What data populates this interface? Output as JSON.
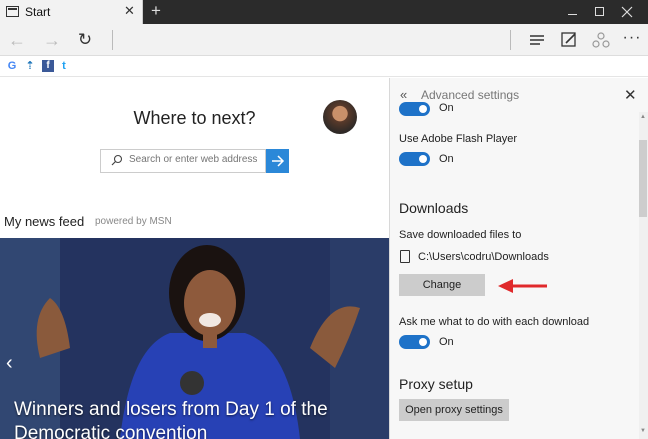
{
  "titlebar": {
    "tab_title": "Start",
    "tab_close": "✕",
    "new_tab": "+"
  },
  "navbar": {
    "back": "←",
    "forward": "→",
    "refresh": "↻",
    "more": "···"
  },
  "favorites": {
    "items": [
      "G",
      "⇡",
      "f",
      "t"
    ]
  },
  "main": {
    "heading": "Where to next?",
    "search_placeholder": "Search or enter web address",
    "news_title": "My news feed",
    "powered_by": "powered by MSN",
    "headline": "Winners and losers from Day 1 of the Democratic convention",
    "prev": "‹"
  },
  "panel": {
    "title": "Advanced settings",
    "back": "«",
    "close": "✕",
    "top_toggle_label": "On",
    "flash_label": "Use Adobe Flash Player",
    "flash_toggle": "On",
    "downloads_heading": "Downloads",
    "save_label": "Save downloaded files to",
    "save_path": "C:\\Users\\codru\\Downloads",
    "change_button": "Change",
    "ask_label": "Ask me what to do with each download",
    "ask_toggle": "On",
    "proxy_heading": "Proxy setup",
    "proxy_button": "Open proxy settings"
  },
  "colors": {
    "accent": "#1e72c8",
    "arrow": "#e0292b",
    "titlebar": "#2b2b2b"
  }
}
